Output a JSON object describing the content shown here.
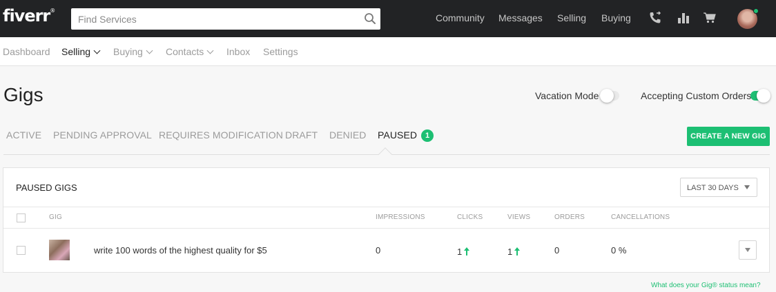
{
  "topbar": {
    "logo": "fiverr",
    "logo_mark": "®",
    "search_placeholder": "Find Services",
    "nav": [
      "Community",
      "Messages",
      "Selling",
      "Buying"
    ],
    "icons": [
      "phone-icon",
      "analytics-icon",
      "cart-icon"
    ],
    "online_color": "#1dbf73"
  },
  "subnav": {
    "items": [
      {
        "label": "Dashboard",
        "dropdown": false,
        "active": false
      },
      {
        "label": "Selling",
        "dropdown": true,
        "active": true
      },
      {
        "label": "Buying",
        "dropdown": true,
        "active": false
      },
      {
        "label": "Contacts",
        "dropdown": true,
        "active": false
      },
      {
        "label": "Inbox",
        "dropdown": false,
        "active": false
      },
      {
        "label": "Settings",
        "dropdown": false,
        "active": false
      }
    ]
  },
  "page": {
    "title": "Gigs",
    "vacation_label": "Vacation Mode",
    "vacation_on": false,
    "custom_orders_label": "Accepting Custom Orders",
    "custom_orders_on": true
  },
  "tabs": {
    "items": [
      "ACTIVE",
      "PENDING APPROVAL",
      "REQUIRES MODIFICATION",
      "DRAFT",
      "DENIED",
      "PAUSED"
    ],
    "active": "PAUSED",
    "paused_count": "1",
    "create_button": "CREATE A NEW GIG"
  },
  "panel": {
    "title": "PAUSED GIGS",
    "range": "LAST 30 DAYS",
    "columns": [
      "GIG",
      "IMPRESSIONS",
      "CLICKS",
      "VIEWS",
      "ORDERS",
      "CANCELLATIONS"
    ],
    "rows": [
      {
        "gig": "write 100 words of the highest quality for $5",
        "impressions": "0",
        "clicks": "1",
        "views": "1",
        "orders": "0",
        "cancellations": "0 %"
      }
    ]
  },
  "footer": {
    "help_link": "What does your Gig® status mean?"
  },
  "colors": {
    "brand_green": "#1dbf73",
    "topbar": "#222325"
  }
}
